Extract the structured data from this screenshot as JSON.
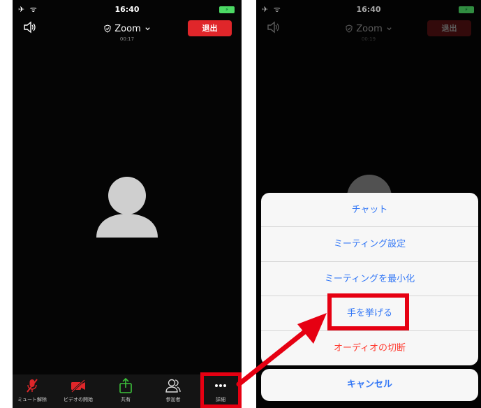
{
  "left_phone": {
    "status": {
      "left": "✈ ᯤ",
      "time": "16:40",
      "battery": "⚡"
    },
    "header": {
      "title": "Zoom",
      "timer": "00:17",
      "leave_label": "退出"
    },
    "toolbar": [
      {
        "name": "unmute",
        "label": "ミュート解除",
        "icon": "mic-muted-icon"
      },
      {
        "name": "start-video",
        "label": "ビデオの開始",
        "icon": "video-off-icon"
      },
      {
        "name": "share",
        "label": "共有",
        "icon": "share-icon"
      },
      {
        "name": "participants",
        "label": "参加者",
        "icon": "participants-icon"
      },
      {
        "name": "more",
        "label": "詳細",
        "icon": "more-icon"
      }
    ]
  },
  "right_phone": {
    "status": {
      "left": "✈ ᯤ",
      "time": "16:40",
      "battery": "⚡"
    },
    "header": {
      "title": "Zoom",
      "timer": "00:19",
      "leave_label": "退出"
    },
    "action_sheet": {
      "items": [
        {
          "label": "チャット",
          "style": "normal"
        },
        {
          "label": "ミーティング設定",
          "style": "normal"
        },
        {
          "label": "ミーティングを最小化",
          "style": "normal"
        },
        {
          "label": "手を挙げる",
          "style": "normal"
        },
        {
          "label": "オーディオの切断",
          "style": "danger"
        }
      ],
      "cancel_label": "キャンセル"
    }
  },
  "colors": {
    "accent_red": "#e60012",
    "leave_red": "#e0262a",
    "link_blue": "#3478f6",
    "danger_red": "#ff3b30",
    "share_green": "#3cc13b"
  }
}
